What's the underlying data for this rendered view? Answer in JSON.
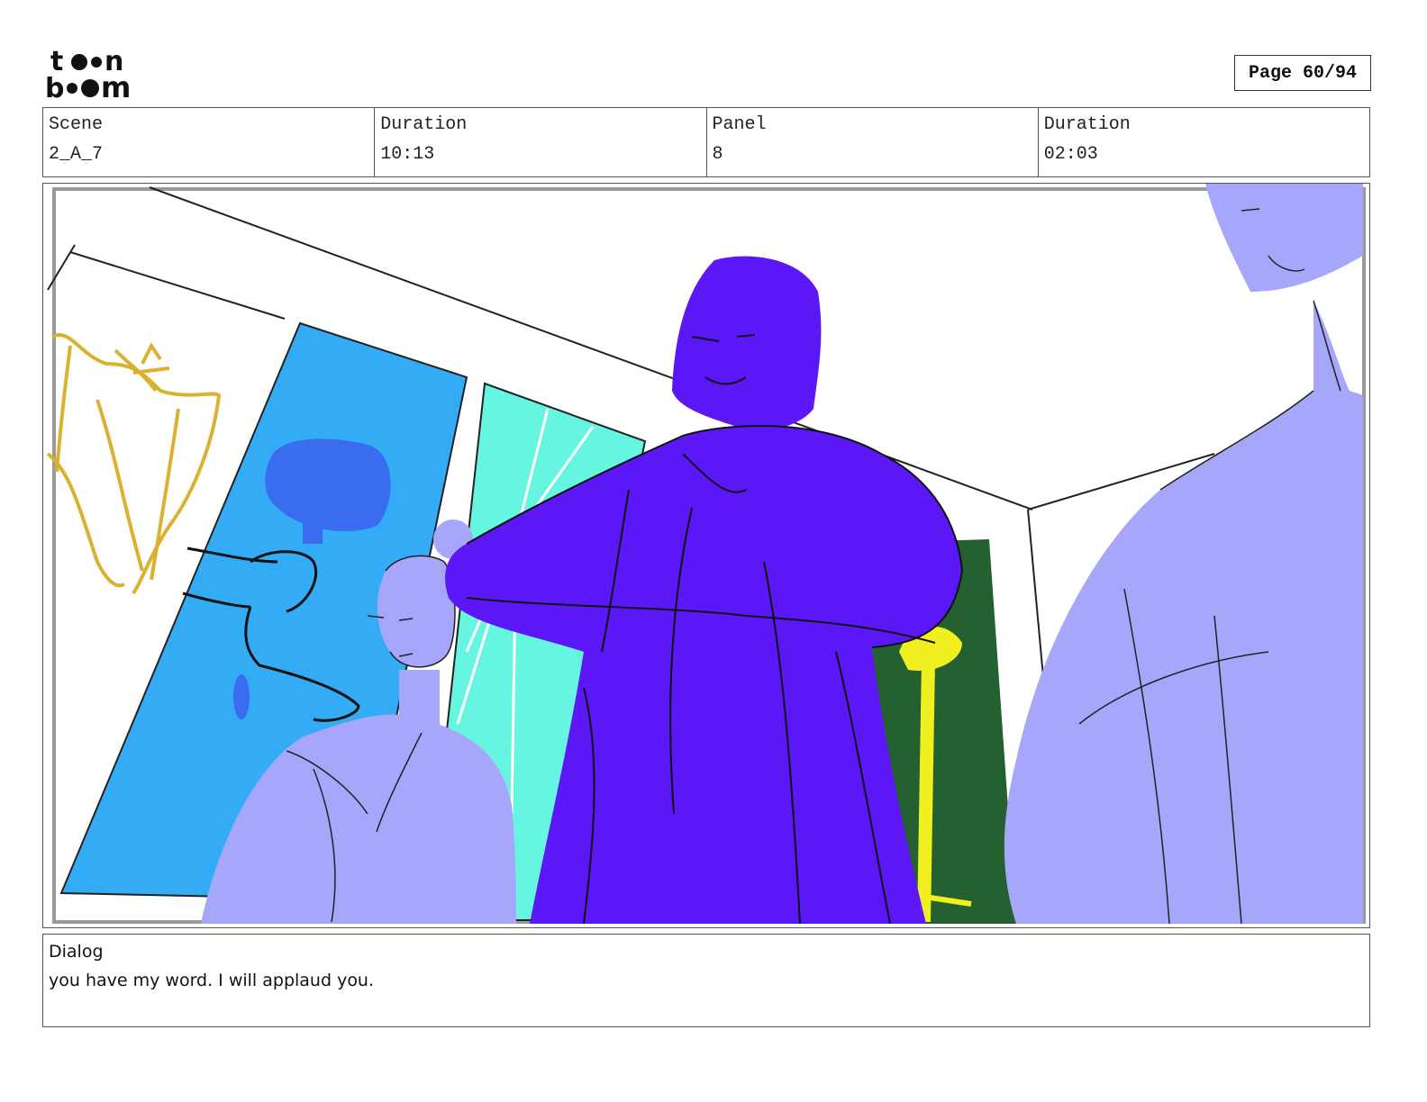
{
  "logo": {
    "text": "toon boom"
  },
  "page": {
    "label": "Page 60/94"
  },
  "info": {
    "scene_label": "Scene",
    "scene_value": "2_A_7",
    "duration_label": "Duration",
    "duration_value": "10:13",
    "panel_label": "Panel",
    "panel_value": "8",
    "panel_duration_label": "Duration",
    "panel_duration_value": "02:03"
  },
  "dialog": {
    "label": "Dialog",
    "text": "you have my word. I will applaud you."
  },
  "colors": {
    "lavender": "#a6a6fa",
    "violet": "#5b17f5",
    "sky_blue": "#33acf5",
    "turquoise": "#66f5e0",
    "forest_green": "#256030",
    "yellow": "#f0f020",
    "gold": "#dab230"
  }
}
